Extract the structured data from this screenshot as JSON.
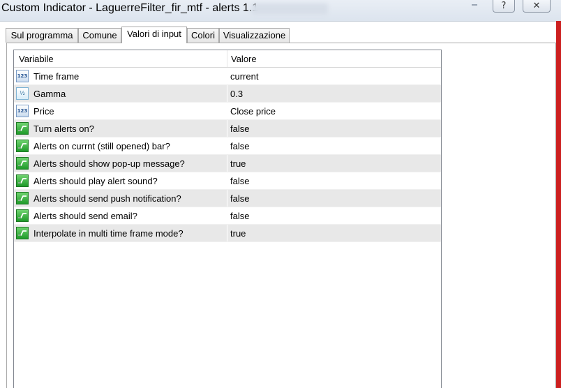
{
  "window": {
    "title": "Custom Indicator - LaguerreFilter_fir_mtf - alerts 1.1",
    "help_glyph": "?",
    "close_glyph": "✕"
  },
  "tabs": [
    {
      "label": "Sul programma",
      "active": false
    },
    {
      "label": "Comune",
      "active": false
    },
    {
      "label": "Valori di input",
      "active": true
    },
    {
      "label": "Colori",
      "active": false
    },
    {
      "label": "Visualizzazione",
      "active": false
    }
  ],
  "grid": {
    "headers": {
      "variable": "Variabile",
      "value": "Valore"
    },
    "rows": [
      {
        "icon": "integer-icon",
        "icon_text": "123",
        "name": "Time frame",
        "value": "current"
      },
      {
        "icon": "double-icon",
        "icon_text": "½",
        "name": "Gamma",
        "value": "0.3"
      },
      {
        "icon": "integer-icon",
        "icon_text": "123",
        "name": "Price",
        "value": "Close price"
      },
      {
        "icon": "boolean-icon",
        "icon_text": "",
        "name": "Turn alerts on?",
        "value": "false"
      },
      {
        "icon": "boolean-icon",
        "icon_text": "",
        "name": "Alerts on currnt (still opened) bar?",
        "value": "false"
      },
      {
        "icon": "boolean-icon",
        "icon_text": "",
        "name": "Alerts should show pop-up message?",
        "value": "true"
      },
      {
        "icon": "boolean-icon",
        "icon_text": "",
        "name": "Alerts should play alert sound?",
        "value": "false"
      },
      {
        "icon": "boolean-icon",
        "icon_text": "",
        "name": "Alerts should send push notification?",
        "value": "false"
      },
      {
        "icon": "boolean-icon",
        "icon_text": "",
        "name": "Alerts should send email?",
        "value": "false"
      },
      {
        "icon": "boolean-icon",
        "icon_text": "",
        "name": "Interpolate in multi time frame mode?",
        "value": "true"
      }
    ]
  },
  "colors": {
    "alt_row": "#e8e8e8",
    "boolean_icon": "#1f9a2a",
    "integer_icon": "#1f4f8f",
    "frame_accent": "#cc2020"
  }
}
